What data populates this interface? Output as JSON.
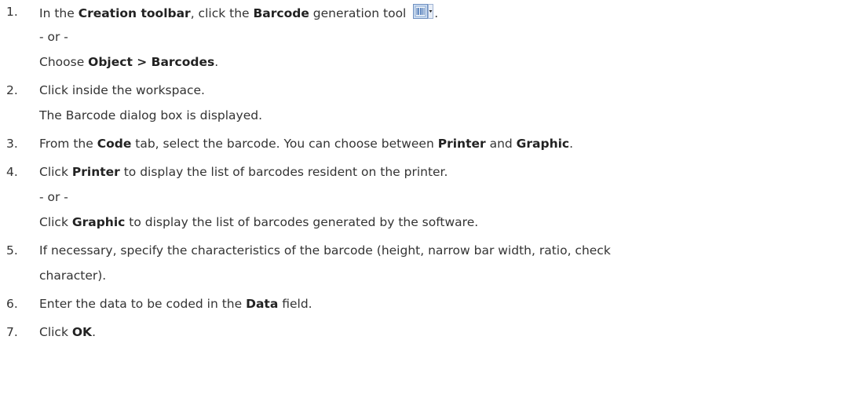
{
  "steps": [
    {
      "number": "1.",
      "parts": [
        {
          "t": "In the "
        },
        {
          "b": "Creation toolbar"
        },
        {
          "t": ", click the "
        },
        {
          "b": "Barcode"
        },
        {
          "t": " generation tool "
        }
      ],
      "icon": "barcode-tool-icon",
      "after_icon": ".",
      "or": "- or -",
      "alt_parts": [
        {
          "t": "Choose "
        },
        {
          "b": "Object > Barcodes"
        },
        {
          "t": "."
        }
      ]
    },
    {
      "number": "2.",
      "text": "Click inside the workspace.",
      "sub": "The Barcode dialog box is displayed."
    },
    {
      "number": "3.",
      "parts": [
        {
          "t": "From the "
        },
        {
          "b": "Code"
        },
        {
          "t": " tab, select the barcode. You can choose between "
        },
        {
          "b": "Printer"
        },
        {
          "t": " and "
        },
        {
          "b": "Graphic"
        },
        {
          "t": "."
        }
      ]
    },
    {
      "number": "4.",
      "parts": [
        {
          "t": "Click "
        },
        {
          "b": "Printer"
        },
        {
          "t": " to display the list of barcodes resident on the printer."
        }
      ],
      "or": "- or -",
      "alt_parts": [
        {
          "t": "Click "
        },
        {
          "b": "Graphic"
        },
        {
          "t": " to display the list of barcodes generated by the software."
        }
      ]
    },
    {
      "number": "5.",
      "text": "If necessary, specify the characteristics of the barcode (height, narrow bar width, ratio, check",
      "sub": "character)."
    },
    {
      "number": "6.",
      "parts": [
        {
          "t": "Enter the data to be coded in the "
        },
        {
          "b": "Data"
        },
        {
          "t": " field."
        }
      ]
    },
    {
      "number": "7.",
      "parts": [
        {
          "t": "Click "
        },
        {
          "b": "OK"
        },
        {
          "t": "."
        }
      ]
    }
  ]
}
